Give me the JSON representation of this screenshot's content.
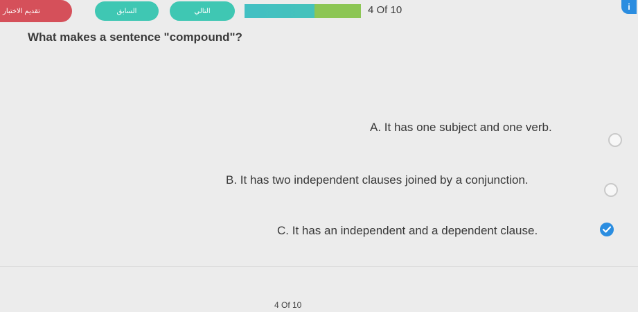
{
  "header": {
    "exam_button_label": "تقديم الاختبار",
    "prev_button_label": "السابق",
    "next_button_label": "التالي",
    "progress_fraction": 0.4,
    "counter": "4 Of 10",
    "info_icon": "info-icon"
  },
  "question": {
    "text": "What makes a sentence \"compound\"?"
  },
  "options": [
    {
      "label": "A. It has one subject and one verb.",
      "selected": false
    },
    {
      "label": "B. It has two independent clauses joined by a conjunction.",
      "selected": false
    },
    {
      "label": "C. It has an independent and a dependent clause.",
      "selected": true
    }
  ],
  "footer": {
    "counter": "4 Of 10"
  },
  "colors": {
    "exam_button": "#d5505a",
    "nav_buttons": "#3fc7b3",
    "progress_fill": "#8cc654",
    "selected_radio": "#2b8de0"
  }
}
